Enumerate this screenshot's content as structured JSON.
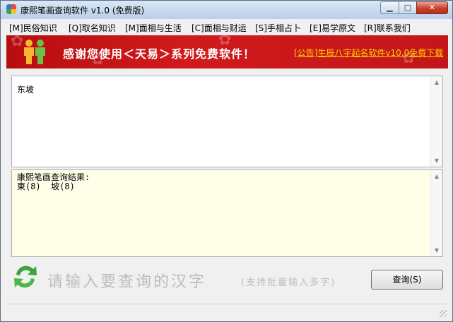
{
  "window": {
    "title": "康熙笔画查询软件 v1.0 (免费版)",
    "controls": {
      "minimize": "▁",
      "maximize": "□",
      "close": "✕"
    }
  },
  "menu": {
    "items": [
      "[M]民俗知识",
      "[Q]取名知识",
      "[M]面相与生活",
      "[C]面相与财运",
      "[S]手相占卜",
      "[E]易学原文",
      "[R]联系我们"
    ]
  },
  "banner": {
    "slogan": "感谢您使用＜天易＞系列免费软件！",
    "announcement_link": "[公告]生辰八字起名软件v10.0免费下载",
    "colors": {
      "background": "#c4161a",
      "link": "#ffd200"
    }
  },
  "input": {
    "value": "东坡"
  },
  "result": {
    "text": "康熙笔画查询结果:\n東(8)  坡(8)"
  },
  "prompt": {
    "main": "请输入要查询的汉字",
    "note": "(支持批量输入多字)"
  },
  "query_button": {
    "label": "查询(S)"
  },
  "icons": {
    "app": "app-icon",
    "logo": "couple-logo-icon",
    "refresh": "refresh-icon"
  }
}
